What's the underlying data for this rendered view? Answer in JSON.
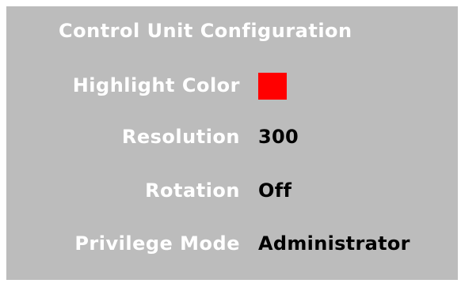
{
  "panel": {
    "title": "Control Unit Configuration",
    "fields": [
      {
        "label": "Highlight Color",
        "value": "",
        "color": "#ff0000"
      },
      {
        "label": "Resolution",
        "value": "300"
      },
      {
        "label": "Rotation",
        "value": "Off"
      },
      {
        "label": "Privilege Mode",
        "value": "Administrator"
      }
    ]
  },
  "colors": {
    "panel_background": "#bcbcbc",
    "label_text": "#ffffff",
    "value_text": "#000000"
  }
}
